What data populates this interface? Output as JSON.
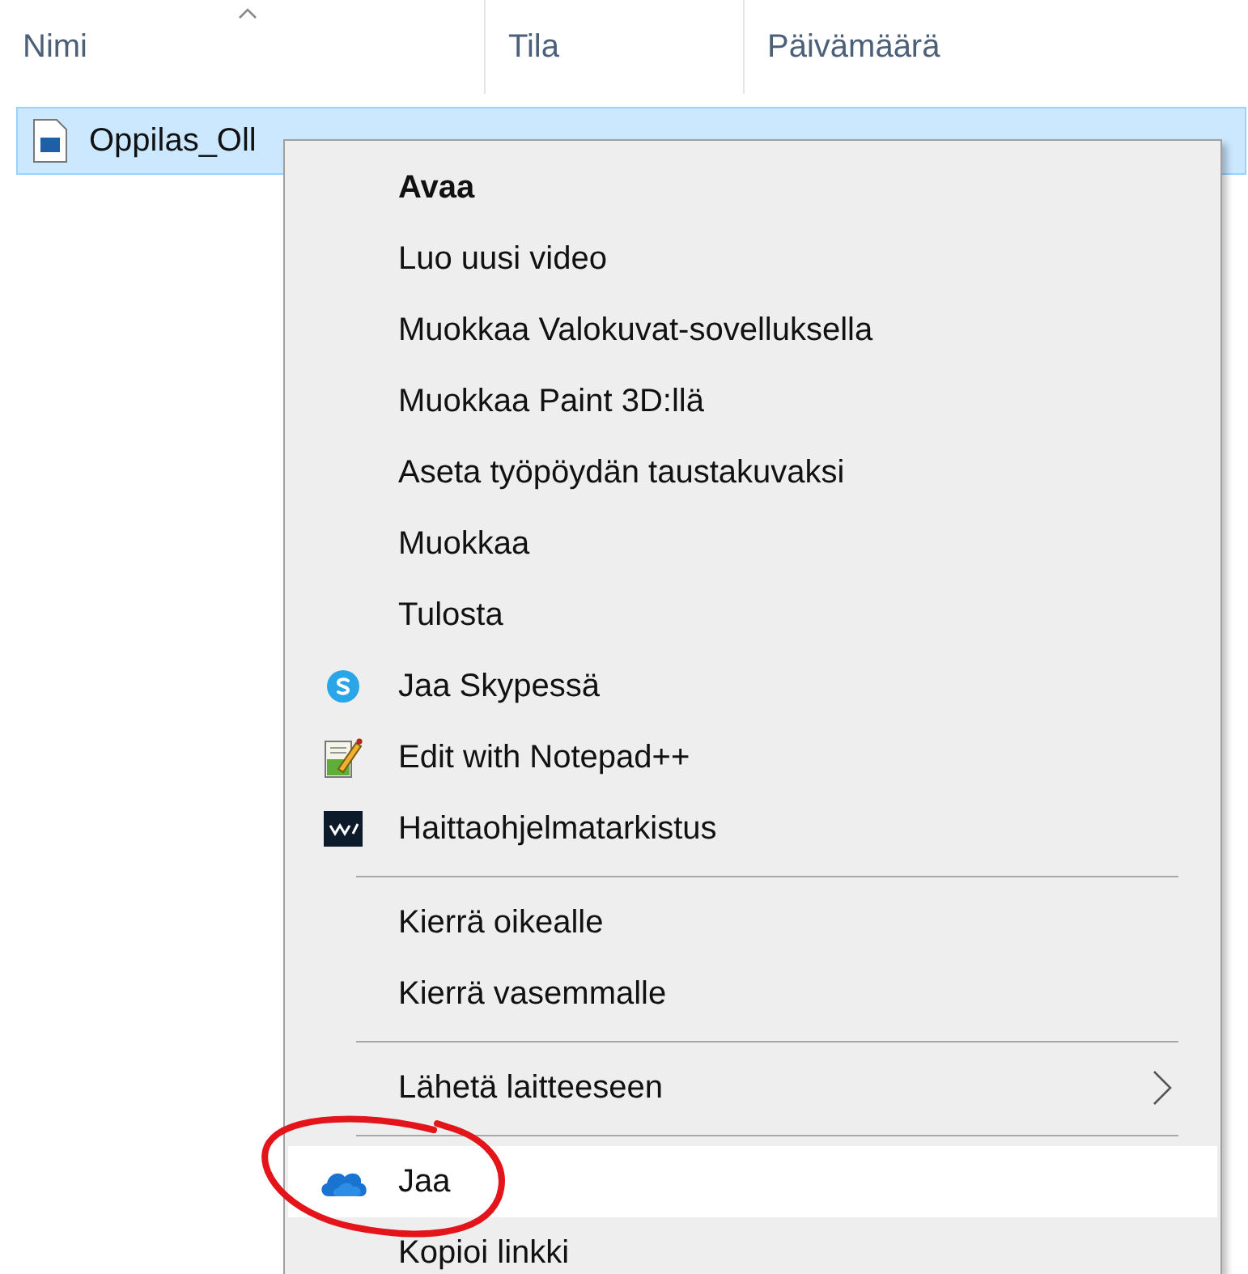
{
  "columns": [
    {
      "label": "Nimi",
      "sorted": true
    },
    {
      "label": "Tila",
      "sorted": false
    },
    {
      "label": "Päivämäärä",
      "sorted": false
    }
  ],
  "file_row": {
    "name": "Oppilas_Oll",
    "selected": true
  },
  "context_menu": [
    {
      "kind": "item",
      "label": "Avaa",
      "default": true,
      "highlighted": false
    },
    {
      "kind": "item",
      "label": "Luo uusi video",
      "default": false,
      "highlighted": false
    },
    {
      "kind": "item",
      "label": "Muokkaa Valokuvat-sovelluksella",
      "default": false,
      "highlighted": false
    },
    {
      "kind": "item",
      "label": "Muokkaa Paint 3D:llä",
      "default": false,
      "highlighted": false
    },
    {
      "kind": "item",
      "label": "Aseta työpöydän taustakuvaksi",
      "default": false,
      "highlighted": false
    },
    {
      "kind": "item",
      "label": "Muokkaa",
      "default": false,
      "highlighted": false
    },
    {
      "kind": "item",
      "label": "Tulosta",
      "default": false,
      "highlighted": false
    },
    {
      "kind": "item",
      "label": "Jaa Skypessä",
      "default": false,
      "highlighted": false
    },
    {
      "kind": "item",
      "label": "Edit with Notepad++",
      "default": false,
      "highlighted": false
    },
    {
      "kind": "item",
      "label": "Haittaohjelmatarkistus",
      "default": false,
      "highlighted": false
    },
    {
      "kind": "separator"
    },
    {
      "kind": "item",
      "label": "Kierrä oikealle",
      "default": false,
      "highlighted": false
    },
    {
      "kind": "item",
      "label": "Kierrä vasemmalle",
      "default": false,
      "highlighted": false
    },
    {
      "kind": "separator"
    },
    {
      "kind": "submenu",
      "label": "Lähetä laitteeseen",
      "default": false,
      "highlighted": false
    },
    {
      "kind": "separator"
    },
    {
      "kind": "item",
      "label": "Jaa",
      "default": false,
      "highlighted": true
    },
    {
      "kind": "item",
      "label": "Kopioi linkki",
      "default": false,
      "highlighted": false
    }
  ]
}
